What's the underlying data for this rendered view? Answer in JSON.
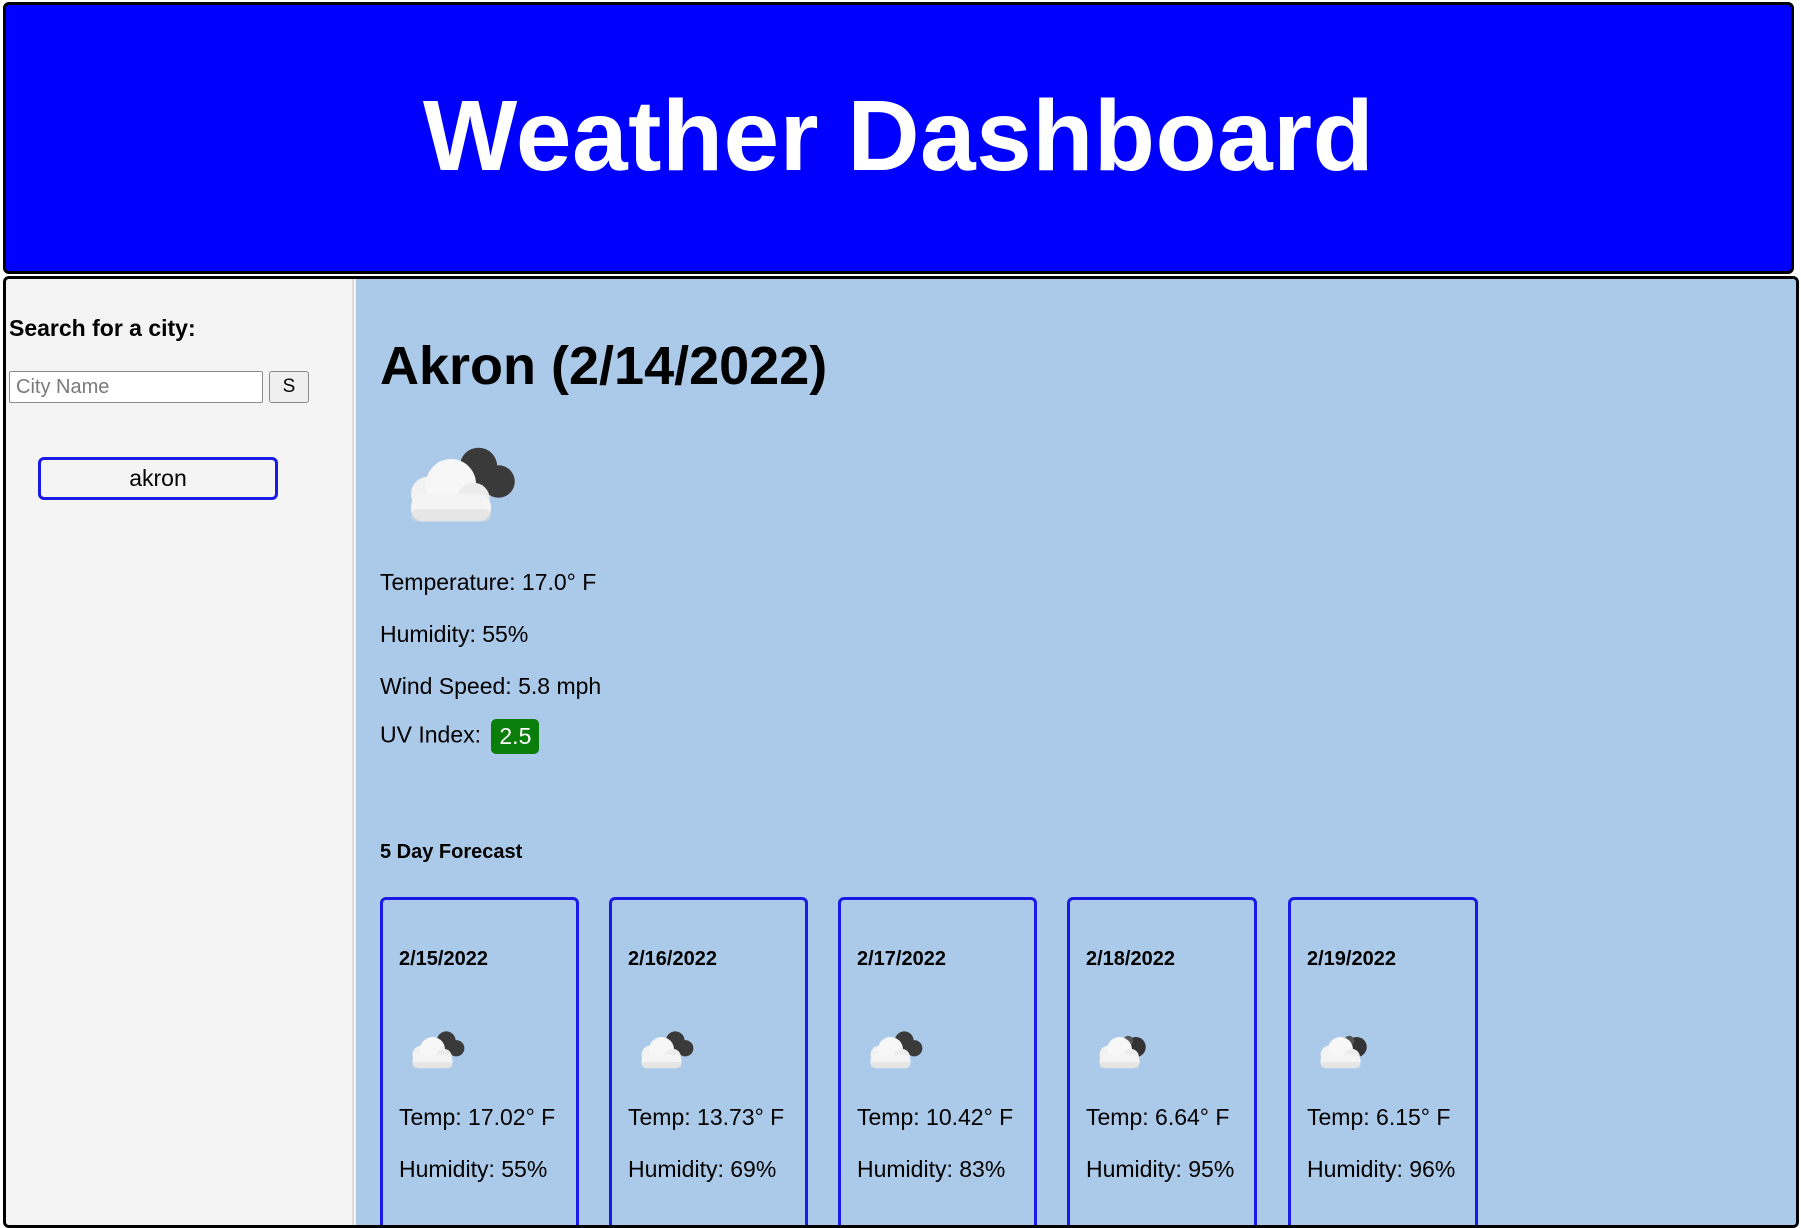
{
  "header": {
    "title": "Weather Dashboard"
  },
  "sidebar": {
    "search_label": "Search for a city:",
    "search_placeholder": "City Name",
    "search_value": "",
    "search_button_label": "S",
    "history": [
      "akron"
    ]
  },
  "current": {
    "title": "Akron (2/14/2022)",
    "icon": "broken-clouds-icon",
    "temperature": "Temperature: 17.0° F",
    "humidity": "Humidity: 55%",
    "wind": "Wind Speed: 5.8 mph",
    "uv_label": "UV Index:",
    "uv_value": "2.5",
    "uv_color": "#0a7d0a"
  },
  "forecast": {
    "label": "5 Day Forecast",
    "days": [
      {
        "date": "2/15/2022",
        "icon": "broken-clouds-icon",
        "temp": "Temp: 17.02° F",
        "humidity": "Humidity: 55%"
      },
      {
        "date": "2/16/2022",
        "icon": "broken-clouds-icon",
        "temp": "Temp: 13.73° F",
        "humidity": "Humidity: 69%"
      },
      {
        "date": "2/17/2022",
        "icon": "broken-clouds-icon",
        "temp": "Temp: 10.42° F",
        "humidity": "Humidity: 83%"
      },
      {
        "date": "2/18/2022",
        "icon": "overcast-clouds-icon",
        "temp": "Temp: 6.64° F",
        "humidity": "Humidity: 95%"
      },
      {
        "date": "2/19/2022",
        "icon": "overcast-clouds-icon",
        "temp": "Temp: 6.15° F",
        "humidity": "Humidity: 96%"
      }
    ]
  },
  "colors": {
    "header_bg": "#0000ff",
    "content_bg": "#abc9e8",
    "sidebar_bg": "#f4f4f4",
    "card_border": "#1a1ae6"
  }
}
